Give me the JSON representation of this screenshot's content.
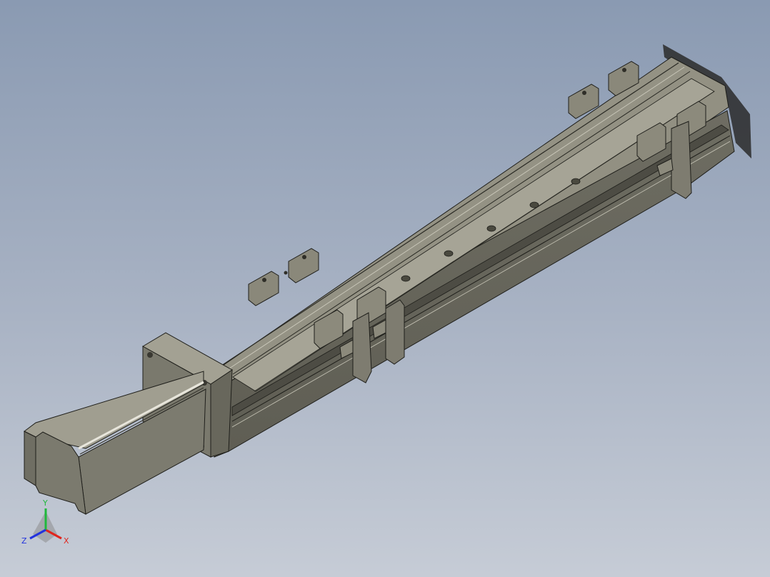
{
  "viewport": {
    "background_top": "#8a9ab2",
    "background_bottom": "#c6ccd6"
  },
  "model": {
    "body_color": "#7f7e72",
    "edge_color": "#1e1e1a"
  },
  "triad": {
    "x_label": "X",
    "y_label": "Y",
    "z_label": "Z",
    "x_color": "#e0261e",
    "y_color": "#1fb83c",
    "z_color": "#2233dd"
  }
}
